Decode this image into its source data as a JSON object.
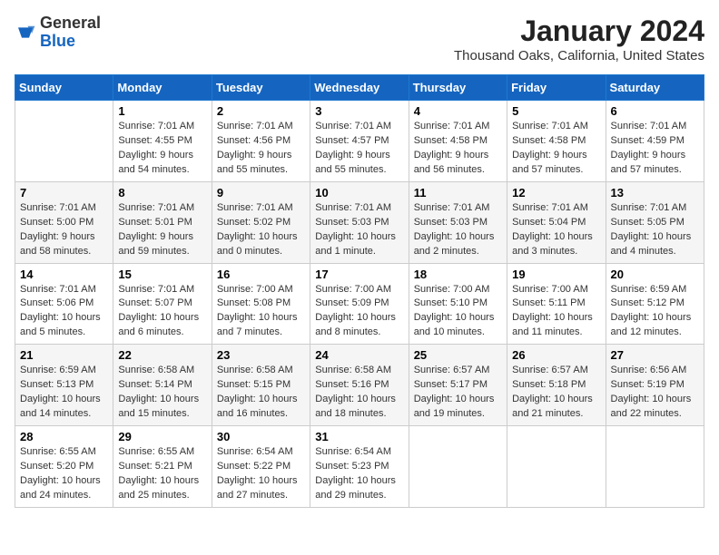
{
  "header": {
    "logo": {
      "general": "General",
      "blue": "Blue"
    },
    "title": "January 2024",
    "subtitle": "Thousand Oaks, California, United States"
  },
  "columns": [
    "Sunday",
    "Monday",
    "Tuesday",
    "Wednesday",
    "Thursday",
    "Friday",
    "Saturday"
  ],
  "weeks": [
    [
      {
        "day": "",
        "info": ""
      },
      {
        "day": "1",
        "info": "Sunrise: 7:01 AM\nSunset: 4:55 PM\nDaylight: 9 hours\nand 54 minutes."
      },
      {
        "day": "2",
        "info": "Sunrise: 7:01 AM\nSunset: 4:56 PM\nDaylight: 9 hours\nand 55 minutes."
      },
      {
        "day": "3",
        "info": "Sunrise: 7:01 AM\nSunset: 4:57 PM\nDaylight: 9 hours\nand 55 minutes."
      },
      {
        "day": "4",
        "info": "Sunrise: 7:01 AM\nSunset: 4:58 PM\nDaylight: 9 hours\nand 56 minutes."
      },
      {
        "day": "5",
        "info": "Sunrise: 7:01 AM\nSunset: 4:58 PM\nDaylight: 9 hours\nand 57 minutes."
      },
      {
        "day": "6",
        "info": "Sunrise: 7:01 AM\nSunset: 4:59 PM\nDaylight: 9 hours\nand 57 minutes."
      }
    ],
    [
      {
        "day": "7",
        "info": "Sunrise: 7:01 AM\nSunset: 5:00 PM\nDaylight: 9 hours\nand 58 minutes."
      },
      {
        "day": "8",
        "info": "Sunrise: 7:01 AM\nSunset: 5:01 PM\nDaylight: 9 hours\nand 59 minutes."
      },
      {
        "day": "9",
        "info": "Sunrise: 7:01 AM\nSunset: 5:02 PM\nDaylight: 10 hours\nand 0 minutes."
      },
      {
        "day": "10",
        "info": "Sunrise: 7:01 AM\nSunset: 5:03 PM\nDaylight: 10 hours\nand 1 minute."
      },
      {
        "day": "11",
        "info": "Sunrise: 7:01 AM\nSunset: 5:03 PM\nDaylight: 10 hours\nand 2 minutes."
      },
      {
        "day": "12",
        "info": "Sunrise: 7:01 AM\nSunset: 5:04 PM\nDaylight: 10 hours\nand 3 minutes."
      },
      {
        "day": "13",
        "info": "Sunrise: 7:01 AM\nSunset: 5:05 PM\nDaylight: 10 hours\nand 4 minutes."
      }
    ],
    [
      {
        "day": "14",
        "info": "Sunrise: 7:01 AM\nSunset: 5:06 PM\nDaylight: 10 hours\nand 5 minutes."
      },
      {
        "day": "15",
        "info": "Sunrise: 7:01 AM\nSunset: 5:07 PM\nDaylight: 10 hours\nand 6 minutes."
      },
      {
        "day": "16",
        "info": "Sunrise: 7:00 AM\nSunset: 5:08 PM\nDaylight: 10 hours\nand 7 minutes."
      },
      {
        "day": "17",
        "info": "Sunrise: 7:00 AM\nSunset: 5:09 PM\nDaylight: 10 hours\nand 8 minutes."
      },
      {
        "day": "18",
        "info": "Sunrise: 7:00 AM\nSunset: 5:10 PM\nDaylight: 10 hours\nand 10 minutes."
      },
      {
        "day": "19",
        "info": "Sunrise: 7:00 AM\nSunset: 5:11 PM\nDaylight: 10 hours\nand 11 minutes."
      },
      {
        "day": "20",
        "info": "Sunrise: 6:59 AM\nSunset: 5:12 PM\nDaylight: 10 hours\nand 12 minutes."
      }
    ],
    [
      {
        "day": "21",
        "info": "Sunrise: 6:59 AM\nSunset: 5:13 PM\nDaylight: 10 hours\nand 14 minutes."
      },
      {
        "day": "22",
        "info": "Sunrise: 6:58 AM\nSunset: 5:14 PM\nDaylight: 10 hours\nand 15 minutes."
      },
      {
        "day": "23",
        "info": "Sunrise: 6:58 AM\nSunset: 5:15 PM\nDaylight: 10 hours\nand 16 minutes."
      },
      {
        "day": "24",
        "info": "Sunrise: 6:58 AM\nSunset: 5:16 PM\nDaylight: 10 hours\nand 18 minutes."
      },
      {
        "day": "25",
        "info": "Sunrise: 6:57 AM\nSunset: 5:17 PM\nDaylight: 10 hours\nand 19 minutes."
      },
      {
        "day": "26",
        "info": "Sunrise: 6:57 AM\nSunset: 5:18 PM\nDaylight: 10 hours\nand 21 minutes."
      },
      {
        "day": "27",
        "info": "Sunrise: 6:56 AM\nSunset: 5:19 PM\nDaylight: 10 hours\nand 22 minutes."
      }
    ],
    [
      {
        "day": "28",
        "info": "Sunrise: 6:55 AM\nSunset: 5:20 PM\nDaylight: 10 hours\nand 24 minutes."
      },
      {
        "day": "29",
        "info": "Sunrise: 6:55 AM\nSunset: 5:21 PM\nDaylight: 10 hours\nand 25 minutes."
      },
      {
        "day": "30",
        "info": "Sunrise: 6:54 AM\nSunset: 5:22 PM\nDaylight: 10 hours\nand 27 minutes."
      },
      {
        "day": "31",
        "info": "Sunrise: 6:54 AM\nSunset: 5:23 PM\nDaylight: 10 hours\nand 29 minutes."
      },
      {
        "day": "",
        "info": ""
      },
      {
        "day": "",
        "info": ""
      },
      {
        "day": "",
        "info": ""
      }
    ]
  ]
}
